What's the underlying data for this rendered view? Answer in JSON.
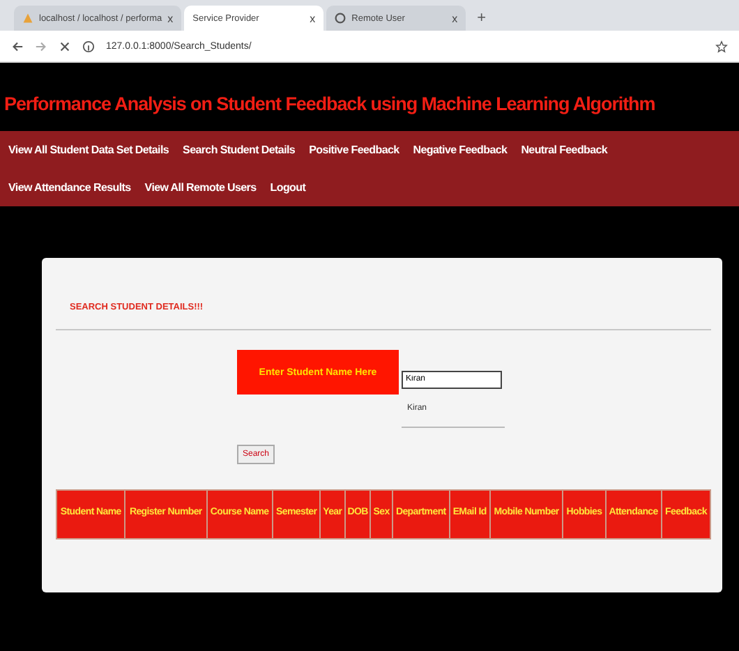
{
  "browser": {
    "tabs": [
      {
        "label": "localhost / localhost / performa",
        "selected": false,
        "close": "x"
      },
      {
        "label": "Service Provider",
        "selected": true,
        "close": "x"
      },
      {
        "label": "Remote User",
        "selected": false,
        "close": "x"
      }
    ],
    "new_tab": "+",
    "url": "127.0.0.1:8000/Search_Students/"
  },
  "page": {
    "title": "Performance Analysis on Student Feedback using Machine Learning Algorithm",
    "nav": [
      [
        "View All Student Data Set Details",
        "Search Student Details",
        "Positive Feedback",
        "Negative Feedback",
        "Neutral Feedback"
      ],
      [
        "View Attendance Results",
        "View All Remote Users",
        "Logout"
      ]
    ]
  },
  "form": {
    "heading": "SEARCH STUDENT DETAILS!!!",
    "label": "Enter Student Name Here",
    "value": "Kiran",
    "suggestions": [
      "Kiran"
    ],
    "button": "Search"
  },
  "table": {
    "columns": [
      "Student Name",
      "Register Number",
      "Course Name",
      "Semester",
      "Year",
      "DOB",
      "Sex",
      "Department",
      "EMail Id",
      "Mobile Number",
      "Hobbies",
      "Attendance",
      "Feedback"
    ]
  }
}
